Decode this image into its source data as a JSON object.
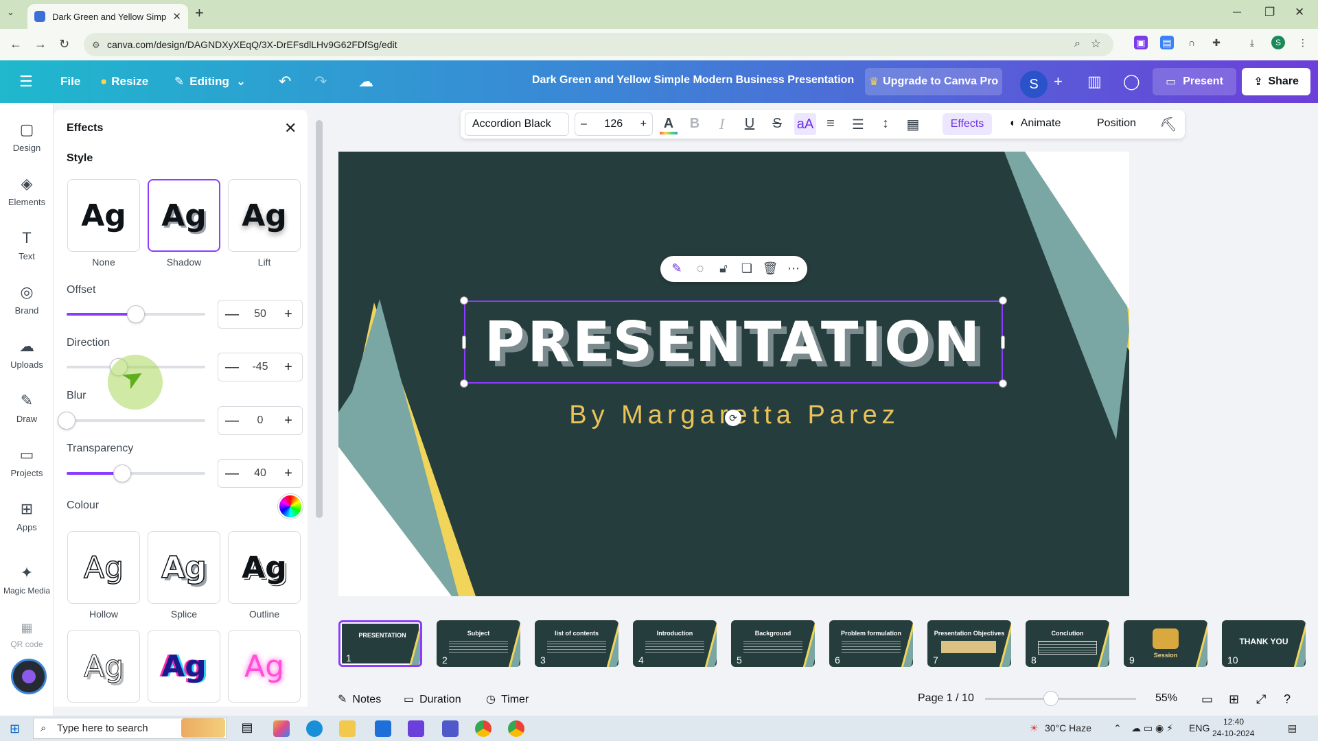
{
  "browser": {
    "tab_title": "Dark Green and Yellow Simple M",
    "url": "canva.com/design/DAGNDXyXEqQ/3X-DrEFsdlLHv9G62FDfSg/edit",
    "profile_initial": "S"
  },
  "header": {
    "file_label": "File",
    "resize_label": "Resize",
    "editing_label": "Editing",
    "doc_title": "Dark Green and Yellow Simple Modern Business Presentation",
    "upgrade_label": "Upgrade to Canva Pro",
    "avatar_initial": "S",
    "present_label": "Present",
    "share_label": "Share"
  },
  "rail": {
    "items": [
      {
        "label": "Design",
        "icon": "▢"
      },
      {
        "label": "Elements",
        "icon": "◈"
      },
      {
        "label": "Text",
        "icon": "T"
      },
      {
        "label": "Brand",
        "icon": "◎"
      },
      {
        "label": "Uploads",
        "icon": "☁"
      },
      {
        "label": "Draw",
        "icon": "✎"
      },
      {
        "label": "Projects",
        "icon": "▭"
      },
      {
        "label": "Apps",
        "icon": "⊞"
      },
      {
        "label": "Magic Media",
        "icon": "✦"
      },
      {
        "label": "QR code",
        "icon": "▦"
      }
    ]
  },
  "effects": {
    "title": "Effects",
    "style_heading": "Style",
    "styles": [
      {
        "label": "None",
        "sample": "Ag"
      },
      {
        "label": "Shadow",
        "sample": "Ag"
      },
      {
        "label": "Lift",
        "sample": "Ag"
      },
      {
        "label": "Hollow",
        "sample": "Ag"
      },
      {
        "label": "Splice",
        "sample": "Ag"
      },
      {
        "label": "Outline",
        "sample": "Ag"
      },
      {
        "label": "",
        "sample": "Ag"
      },
      {
        "label": "",
        "sample": "Ag"
      },
      {
        "label": "",
        "sample": "Ag"
      }
    ],
    "offset": {
      "label": "Offset",
      "value": "50",
      "fraction": 0.5
    },
    "direction": {
      "label": "Direction",
      "value": "-45",
      "fraction": 0.375
    },
    "blur": {
      "label": "Blur",
      "value": "0",
      "fraction": 0.0
    },
    "transparency": {
      "label": "Transparency",
      "value": "40",
      "fraction": 0.4
    },
    "colour_label": "Colour"
  },
  "toolbar": {
    "font": "Accordion Black",
    "size": "126",
    "effects_label": "Effects",
    "animate_label": "Animate",
    "position_label": "Position"
  },
  "slide": {
    "title": "PRESENTATION",
    "subtitle": "By Margaretta Parez"
  },
  "thumbnails": [
    {
      "num": "1",
      "title": "PRESENTATION"
    },
    {
      "num": "2",
      "title": "Subject"
    },
    {
      "num": "3",
      "title": "list of contents"
    },
    {
      "num": "4",
      "title": "Introduction"
    },
    {
      "num": "5",
      "title": "Background"
    },
    {
      "num": "6",
      "title": "Problem formulation"
    },
    {
      "num": "7",
      "title": "Presentation Objectives"
    },
    {
      "num": "8",
      "title": "Conclution"
    },
    {
      "num": "9",
      "title": "Session"
    },
    {
      "num": "10",
      "title": "THANK YOU"
    }
  ],
  "footer": {
    "notes_label": "Notes",
    "duration_label": "Duration",
    "timer_label": "Timer",
    "page_label": "Page 1 / 10",
    "zoom_label": "55%"
  },
  "taskbar": {
    "search_placeholder": "Type here to search",
    "weather": "30°C  Haze",
    "lang": "ENG",
    "time": "12:40",
    "date": "24-10-2024"
  },
  "colors": {
    "accent": "#8b3dff",
    "slide_bg": "#263d3d",
    "slide_yellow": "#f1d55a",
    "slide_teal": "#7aa7a3"
  }
}
